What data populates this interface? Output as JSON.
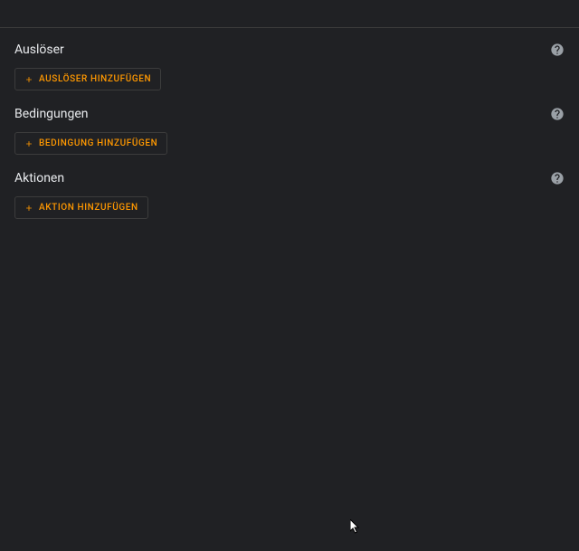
{
  "sections": {
    "triggers": {
      "title": "Auslöser",
      "add_label": "AUSLÖSER HINZUFÜGEN"
    },
    "conditions": {
      "title": "Bedingungen",
      "add_label": "BEDINGUNG HINZUFÜGEN"
    },
    "actions": {
      "title": "Aktionen",
      "add_label": "AKTION HINZUFÜGEN"
    }
  }
}
